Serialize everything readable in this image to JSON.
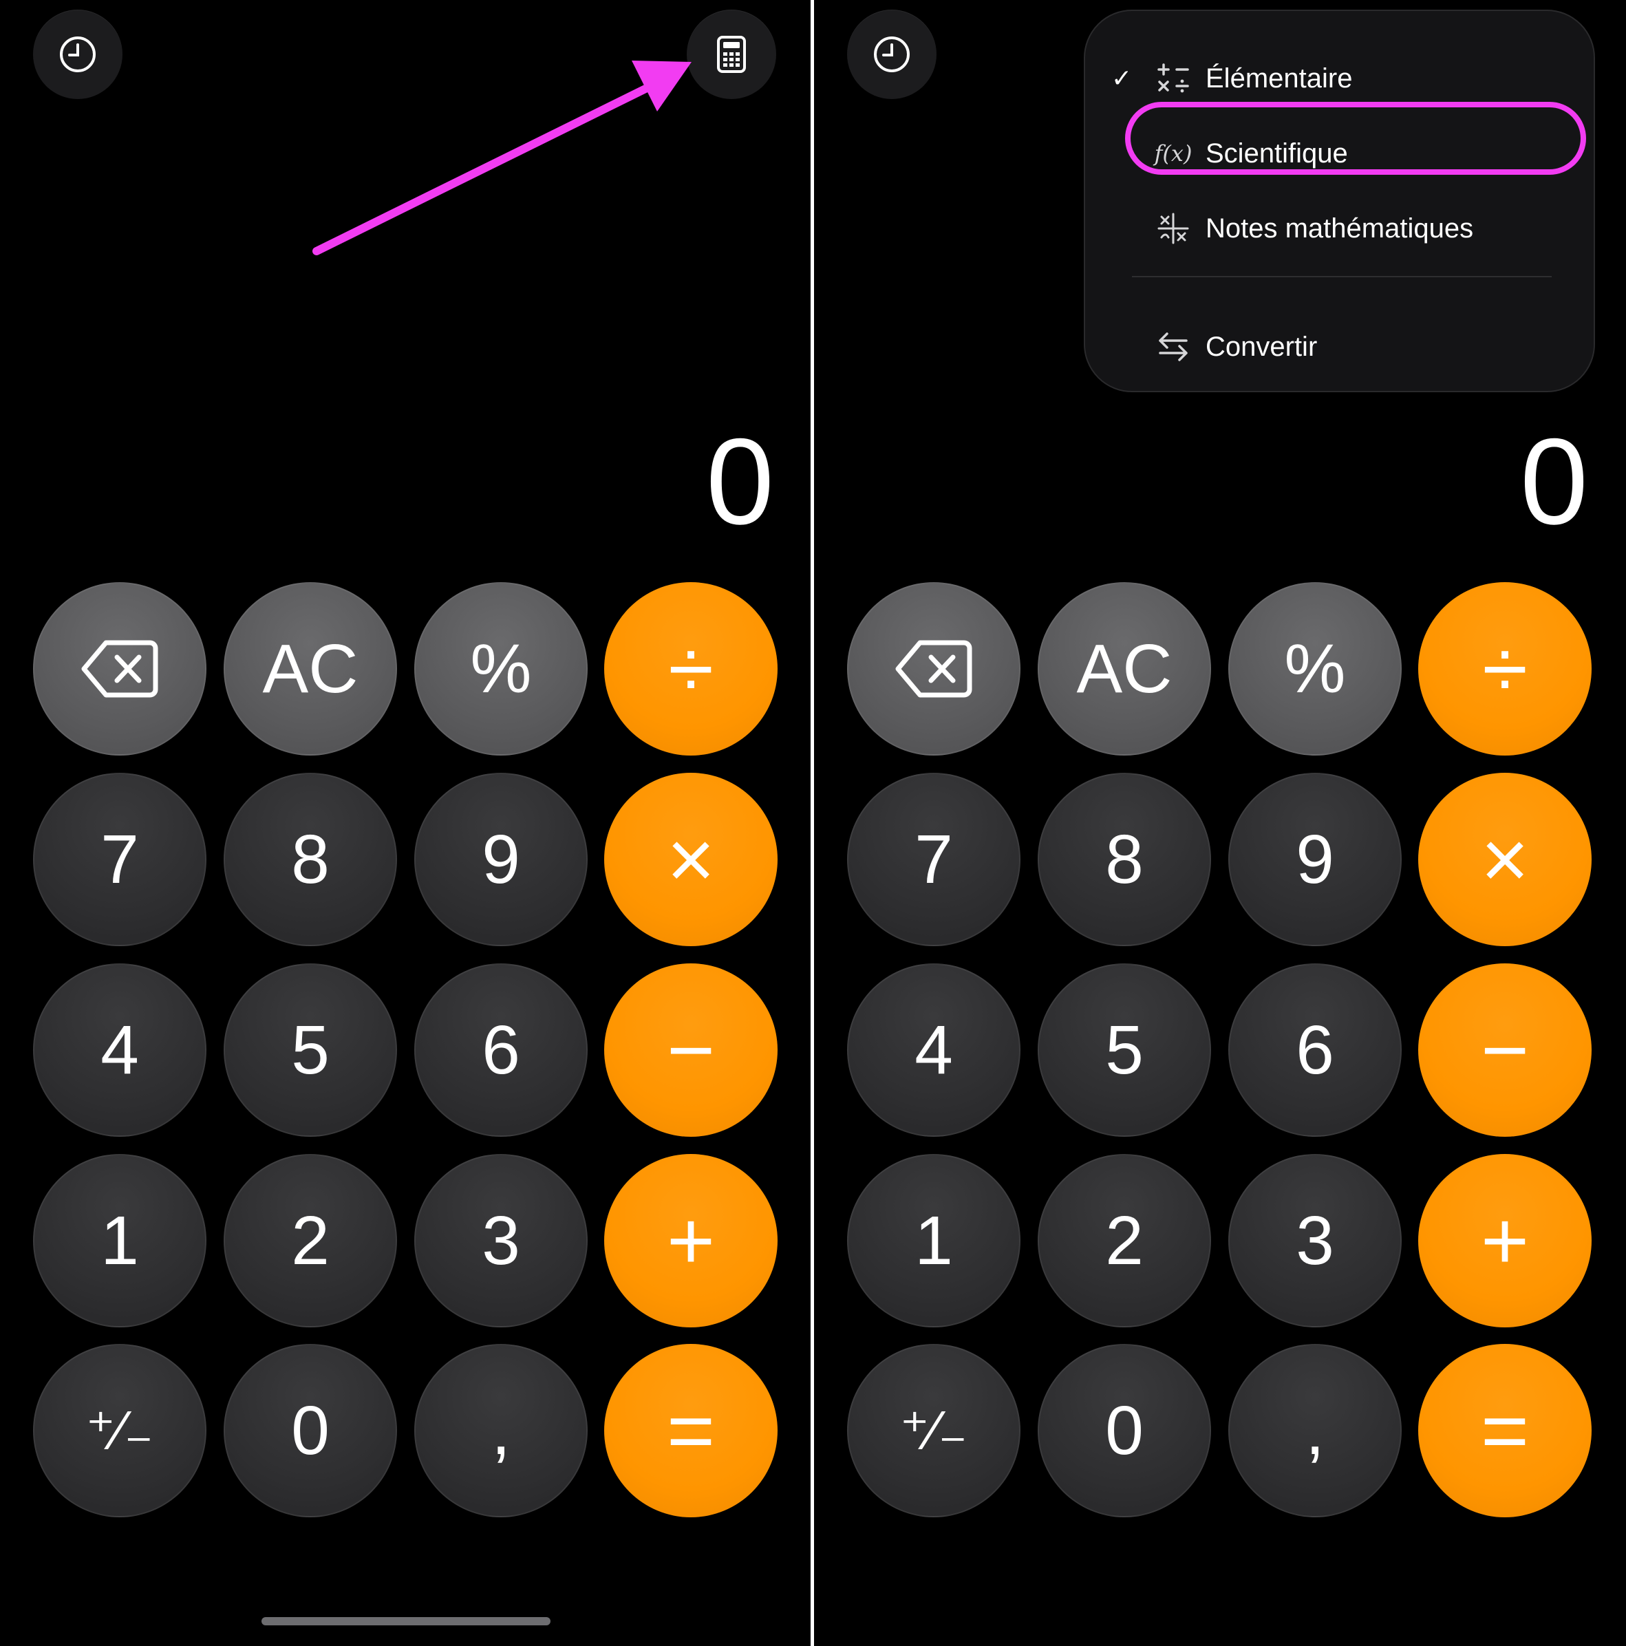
{
  "left_panel": {
    "display": "0",
    "keys": {
      "backspace": "backspace",
      "clear": "AC",
      "percent": "%",
      "divide": "÷",
      "seven": "7",
      "eight": "8",
      "nine": "9",
      "multiply": "×",
      "four": "4",
      "five": "5",
      "six": "6",
      "minus": "−",
      "one": "1",
      "two": "2",
      "three": "3",
      "plus": "+",
      "sign": "⁺⁄₋",
      "zero": "0",
      "decimal": ",",
      "equals": "="
    }
  },
  "right_panel": {
    "display": "0",
    "keys": {
      "backspace": "backspace",
      "clear": "AC",
      "percent": "%",
      "divide": "÷",
      "seven": "7",
      "eight": "8",
      "nine": "9",
      "multiply": "×",
      "four": "4",
      "five": "5",
      "six": "6",
      "minus": "−",
      "one": "1",
      "two": "2",
      "three": "3",
      "plus": "+",
      "sign": "⁺⁄₋",
      "zero": "0",
      "decimal": ",",
      "equals": "="
    },
    "menu": {
      "items": [
        {
          "label": "Élémentaire",
          "icon": "basic-ops-icon",
          "checked": true
        },
        {
          "label": "Scientifique",
          "icon": "function-icon",
          "checked": false
        },
        {
          "label": "Notes mathématiques",
          "icon": "math-notes-icon",
          "checked": false
        },
        {
          "label": "Convertir",
          "icon": "convert-arrows-icon",
          "checked": false
        }
      ],
      "check_mark": "✓",
      "fx_glyph": "f(x)"
    }
  },
  "colors": {
    "background": "#000000",
    "operator": "#ff9500",
    "function_key": "#5a5a5c",
    "number_key": "#2e2e30",
    "annotation": "#f23cf2"
  }
}
